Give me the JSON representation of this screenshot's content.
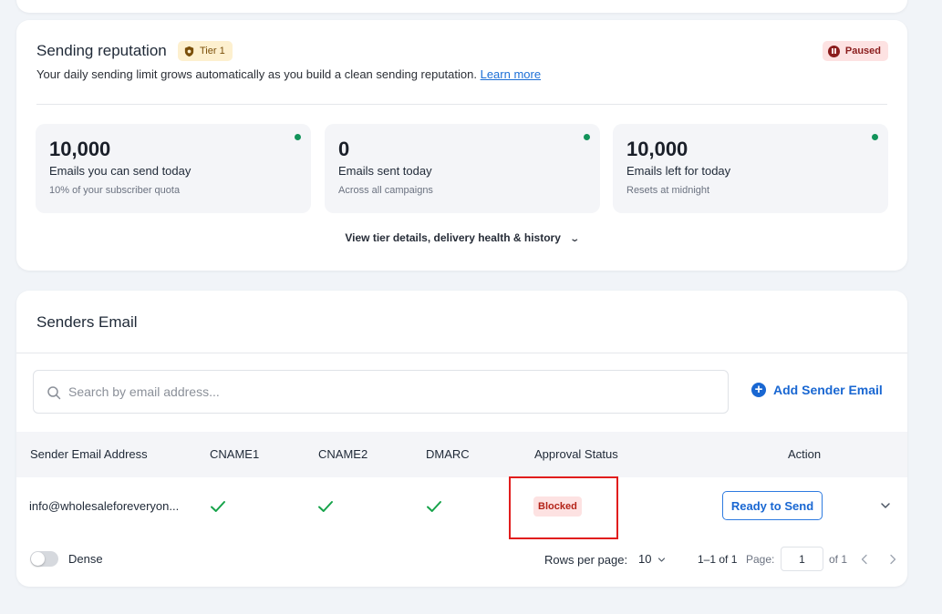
{
  "reputation": {
    "title": "Sending reputation",
    "tier_badge": "Tier 1",
    "status_badge": "Paused",
    "description": "Your daily sending limit grows automatically as you build a clean sending reputation.",
    "learn_more": "Learn more",
    "stats": [
      {
        "value": "10,000",
        "label": "Emails you can send today",
        "sub": "10% of your subscriber quota"
      },
      {
        "value": "0",
        "label": "Emails sent today",
        "sub": "Across all campaigns"
      },
      {
        "value": "10,000",
        "label": "Emails left for today",
        "sub": "Resets at midnight"
      }
    ],
    "view_details": "View tier details, delivery health & history"
  },
  "senders": {
    "title": "Senders Email",
    "search_placeholder": "Search by email address...",
    "add_button": "Add Sender Email",
    "columns": [
      "Sender Email Address",
      "CNAME1",
      "CNAME2",
      "DMARC",
      "Approval Status",
      "Action"
    ],
    "rows": [
      {
        "email": "info@wholesaleforeveryon...",
        "cname1": "verified",
        "cname2": "verified",
        "dmarc": "verified",
        "status": "Blocked",
        "action": "Ready to Send"
      }
    ],
    "footer": {
      "dense_label": "Dense",
      "rows_per_page_label": "Rows per page:",
      "rows_per_page_value": "10",
      "range": "1–1 of 1",
      "page_label": "Page:",
      "page_value": "1",
      "of_pages": "of 1"
    }
  },
  "colors": {
    "accent": "#1967d2",
    "success": "#12935a",
    "danger": "#b42318",
    "highlight": "#e11d1d"
  }
}
